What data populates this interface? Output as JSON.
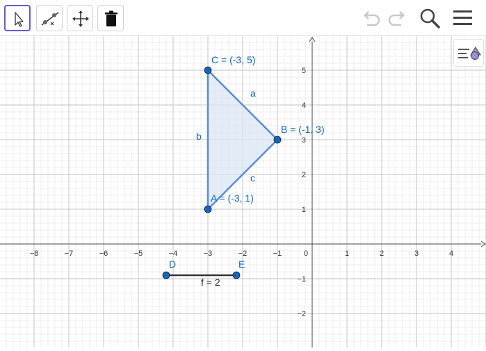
{
  "toolbar": {
    "tools": [
      {
        "name": "move-tool",
        "icon": "pointer-arrow-icon",
        "active": true
      },
      {
        "name": "segment-tool",
        "icon": "segment-through-point-icon",
        "active": false
      },
      {
        "name": "move-graphics-tool",
        "icon": "move-arrows-icon",
        "active": false
      },
      {
        "name": "delete-tool",
        "icon": "trash-icon",
        "active": false
      }
    ],
    "right": [
      "undo-icon",
      "redo-icon",
      "search-icon",
      "menu-icon"
    ]
  },
  "graph": {
    "x_ticks": [
      "−8",
      "−7",
      "−6",
      "−5",
      "−4",
      "−3",
      "−2",
      "−1",
      "0",
      "1",
      "2",
      "3",
      "4"
    ],
    "y_ticks_pos": [
      "1",
      "2",
      "3",
      "4",
      "5"
    ],
    "y_ticks_neg": [
      "−1",
      "−2"
    ],
    "point_A": {
      "label": "A = (-3, 1)",
      "x": -3,
      "y": 1
    },
    "point_B": {
      "label": "B = (-1, 3)",
      "x": -1,
      "y": 3
    },
    "point_C": {
      "label": "C = (-3, 5)",
      "x": -3,
      "y": 5
    },
    "point_D": {
      "label": "D",
      "x": -4.2,
      "y": -0.9
    },
    "point_E": {
      "label": "E",
      "x": -2.2,
      "y": -0.9
    },
    "segment_a": "a",
    "segment_b": "b",
    "segment_c": "c",
    "segment_f": "f = 2"
  },
  "colors": {
    "accent": "#1565c0",
    "triangle_fill": "#dbe5f5",
    "triangle_stroke": "#5b8bd0",
    "point_fill": "#1565c0",
    "active_tool": "#6557d2"
  }
}
